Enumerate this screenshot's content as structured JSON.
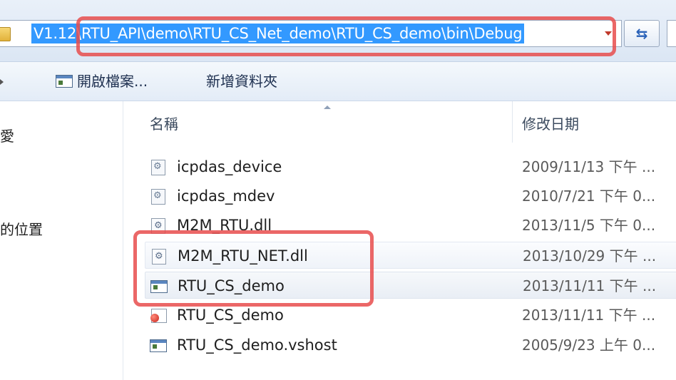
{
  "address_bar": {
    "path": "V1.12\\RTU_API\\demo\\RTU_CS_Net_demo\\RTU_CS_demo\\bin\\Debug",
    "refresh_icon": "refresh-icon",
    "dropdown_icon": "chevron-down-icon"
  },
  "toolbar": {
    "open_label": "開啟檔案...",
    "new_folder_label": "新增資料夾"
  },
  "nav_pane": {
    "items": [
      "愛",
      "的位置"
    ]
  },
  "columns": {
    "name": "名稱",
    "date_modified": "修改日期"
  },
  "files": [
    {
      "name": "icpdas_device",
      "date": "2009/11/13 下午 ...",
      "icon": "config-file-icon"
    },
    {
      "name": "icpdas_mdev",
      "date": "2010/7/21 下午 0...",
      "icon": "config-file-icon"
    },
    {
      "name": "M2M_RTU.dll",
      "date": "2013/11/5 下午 0...",
      "icon": "dll-file-icon"
    },
    {
      "name": "M2M_RTU_NET.dll",
      "date": "2013/10/29 下午 ...",
      "icon": "dll-file-icon"
    },
    {
      "name": "RTU_CS_demo",
      "date": "2013/11/11 下午 ...",
      "icon": "application-icon"
    },
    {
      "name": "RTU_CS_demo",
      "date": "2013/11/11 下午 ...",
      "icon": "project-file-icon"
    },
    {
      "name": "RTU_CS_demo.vshost",
      "date": "2005/9/23 上午 0...",
      "icon": "application-icon"
    }
  ],
  "colors": {
    "selection": "#3399ff",
    "annotation": "#e74c4c"
  }
}
